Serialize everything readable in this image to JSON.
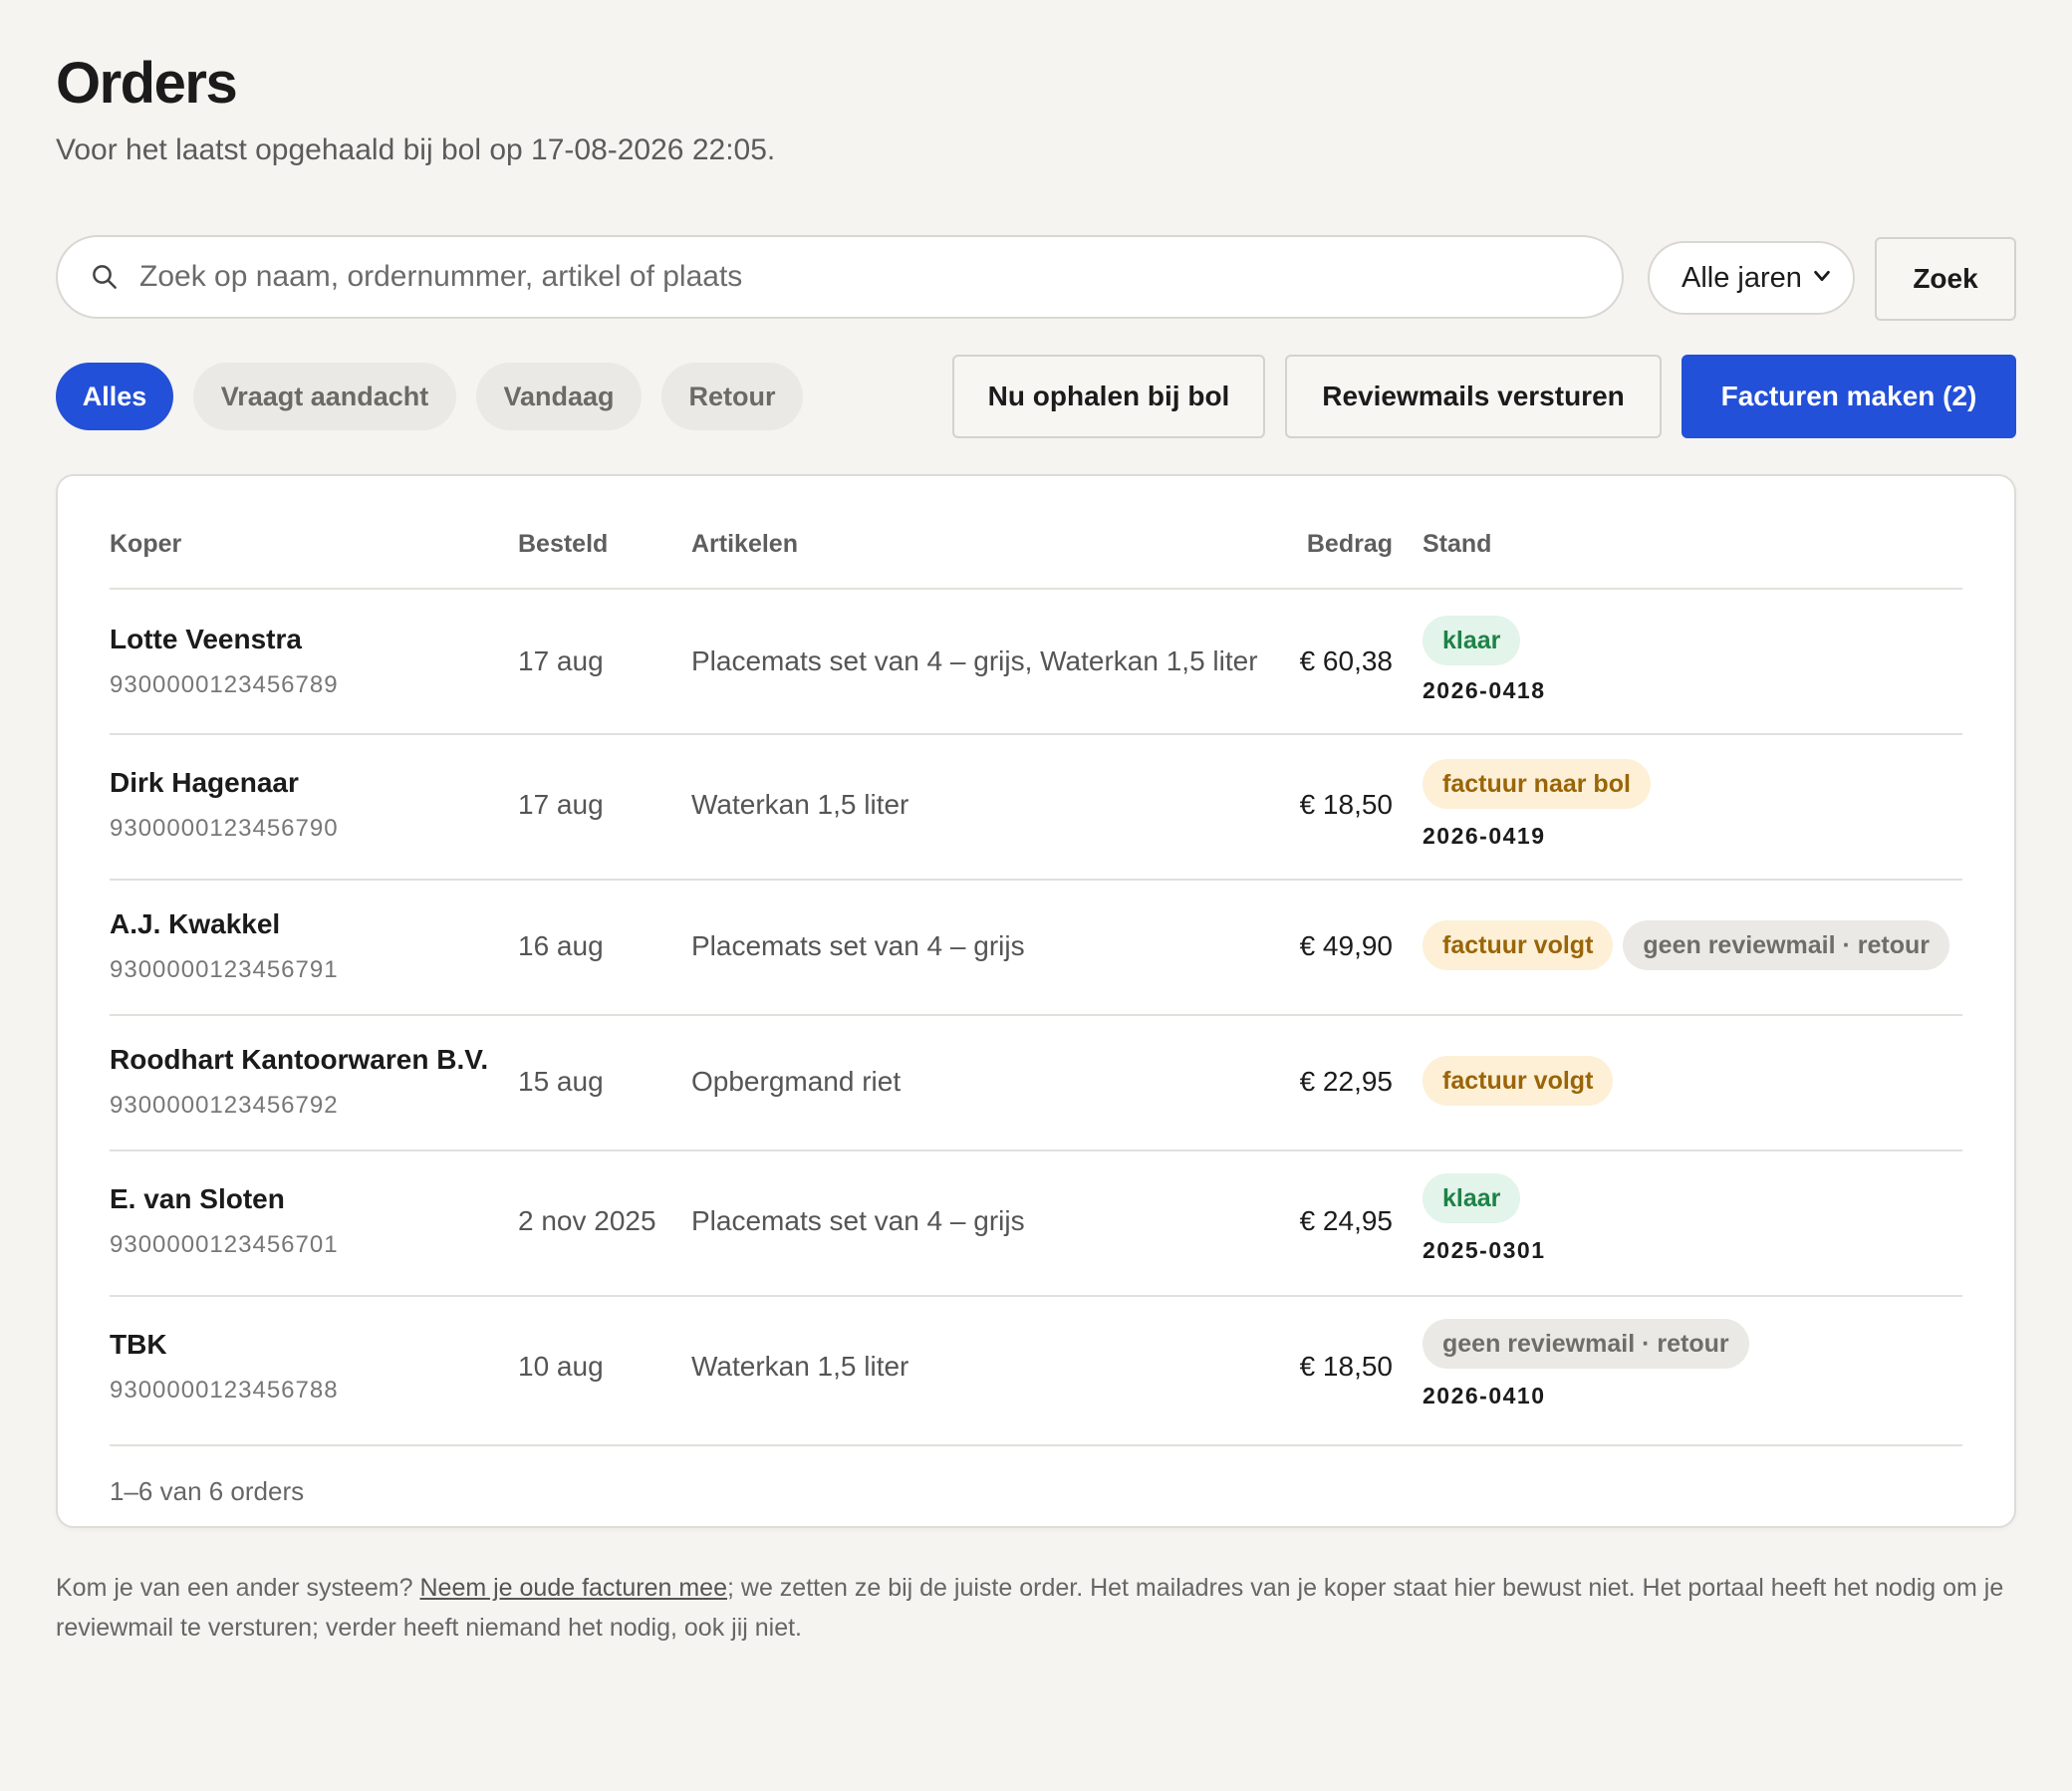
{
  "page": {
    "title": "Orders",
    "subtitle": "Voor het laatst opgehaald bij bol op 17-08-2026 22:05."
  },
  "search": {
    "placeholder": "Zoek op naam, ordernummer, artikel of plaats",
    "icon": "search-icon"
  },
  "year_filter": {
    "selected": "Alle jaren"
  },
  "buttons": {
    "search": "Zoek",
    "fetch": "Nu ophalen bij bol",
    "review": "Reviewmails versturen",
    "invoices": "Facturen maken (2)"
  },
  "filters": [
    {
      "label": "Alles",
      "active": true
    },
    {
      "label": "Vraagt aandacht",
      "active": false
    },
    {
      "label": "Vandaag",
      "active": false
    },
    {
      "label": "Retour",
      "active": false
    }
  ],
  "table": {
    "headers": {
      "buyer": "Koper",
      "ordered": "Besteld",
      "items": "Artikelen",
      "amount": "Bedrag",
      "status": "Stand"
    },
    "rows": [
      {
        "name": "Lotte Veenstra",
        "order_no": "9300000123456789",
        "date": "17 aug",
        "items": "Placemats set van 4 – grijs, Waterkan 1,5 liter",
        "amount": "€ 60,38",
        "badges": [
          {
            "text": "klaar",
            "tone": "green"
          }
        ],
        "invoice": "2026-0418"
      },
      {
        "name": "Dirk Hagenaar",
        "order_no": "9300000123456790",
        "date": "17 aug",
        "items": "Waterkan 1,5 liter",
        "amount": "€ 18,50",
        "badges": [
          {
            "text": "factuur naar bol",
            "tone": "amber"
          }
        ],
        "invoice": "2026-0419"
      },
      {
        "name": "A.J. Kwakkel",
        "order_no": "9300000123456791",
        "date": "16 aug",
        "items": "Placemats set van 4 – grijs",
        "amount": "€ 49,90",
        "badges": [
          {
            "text": "factuur volgt",
            "tone": "amber"
          },
          {
            "text": "geen reviewmail · retour",
            "tone": "grey"
          }
        ],
        "invoice": ""
      },
      {
        "name": "Roodhart Kantoorwaren B.V.",
        "order_no": "9300000123456792",
        "date": "15 aug",
        "items": "Opbergmand riet",
        "amount": "€ 22,95",
        "badges": [
          {
            "text": "factuur volgt",
            "tone": "amber"
          }
        ],
        "invoice": ""
      },
      {
        "name": "E. van Sloten",
        "order_no": "9300000123456701",
        "date": "2 nov 2025",
        "items": "Placemats set van 4 – grijs",
        "amount": "€ 24,95",
        "badges": [
          {
            "text": "klaar",
            "tone": "green"
          }
        ],
        "invoice": "2025-0301"
      },
      {
        "name": "TBK",
        "order_no": "9300000123456788",
        "date": "10 aug",
        "items": "Waterkan 1,5 liter",
        "amount": "€ 18,50",
        "badges": [
          {
            "text": "geen reviewmail · retour",
            "tone": "grey"
          }
        ],
        "invoice": "2026-0410"
      }
    ],
    "pagination": "1–6 van 6 orders"
  },
  "footer": {
    "before_link": "Kom je van een ander systeem? ",
    "link": "Neem je oude facturen mee",
    "after_link": "; we zetten ze bij de juiste order. Het mailadres van je koper staat hier bewust niet. Het portaal heeft het nodig om je reviewmail te versturen; verder heeft niemand het nodig, ook jij niet."
  },
  "colors": {
    "accent": "#2350d8",
    "background": "#f5f4f1",
    "badge_green_text": "#1e8247",
    "badge_amber_text": "#9a6508",
    "badge_grey_text": "#6e6d69"
  }
}
